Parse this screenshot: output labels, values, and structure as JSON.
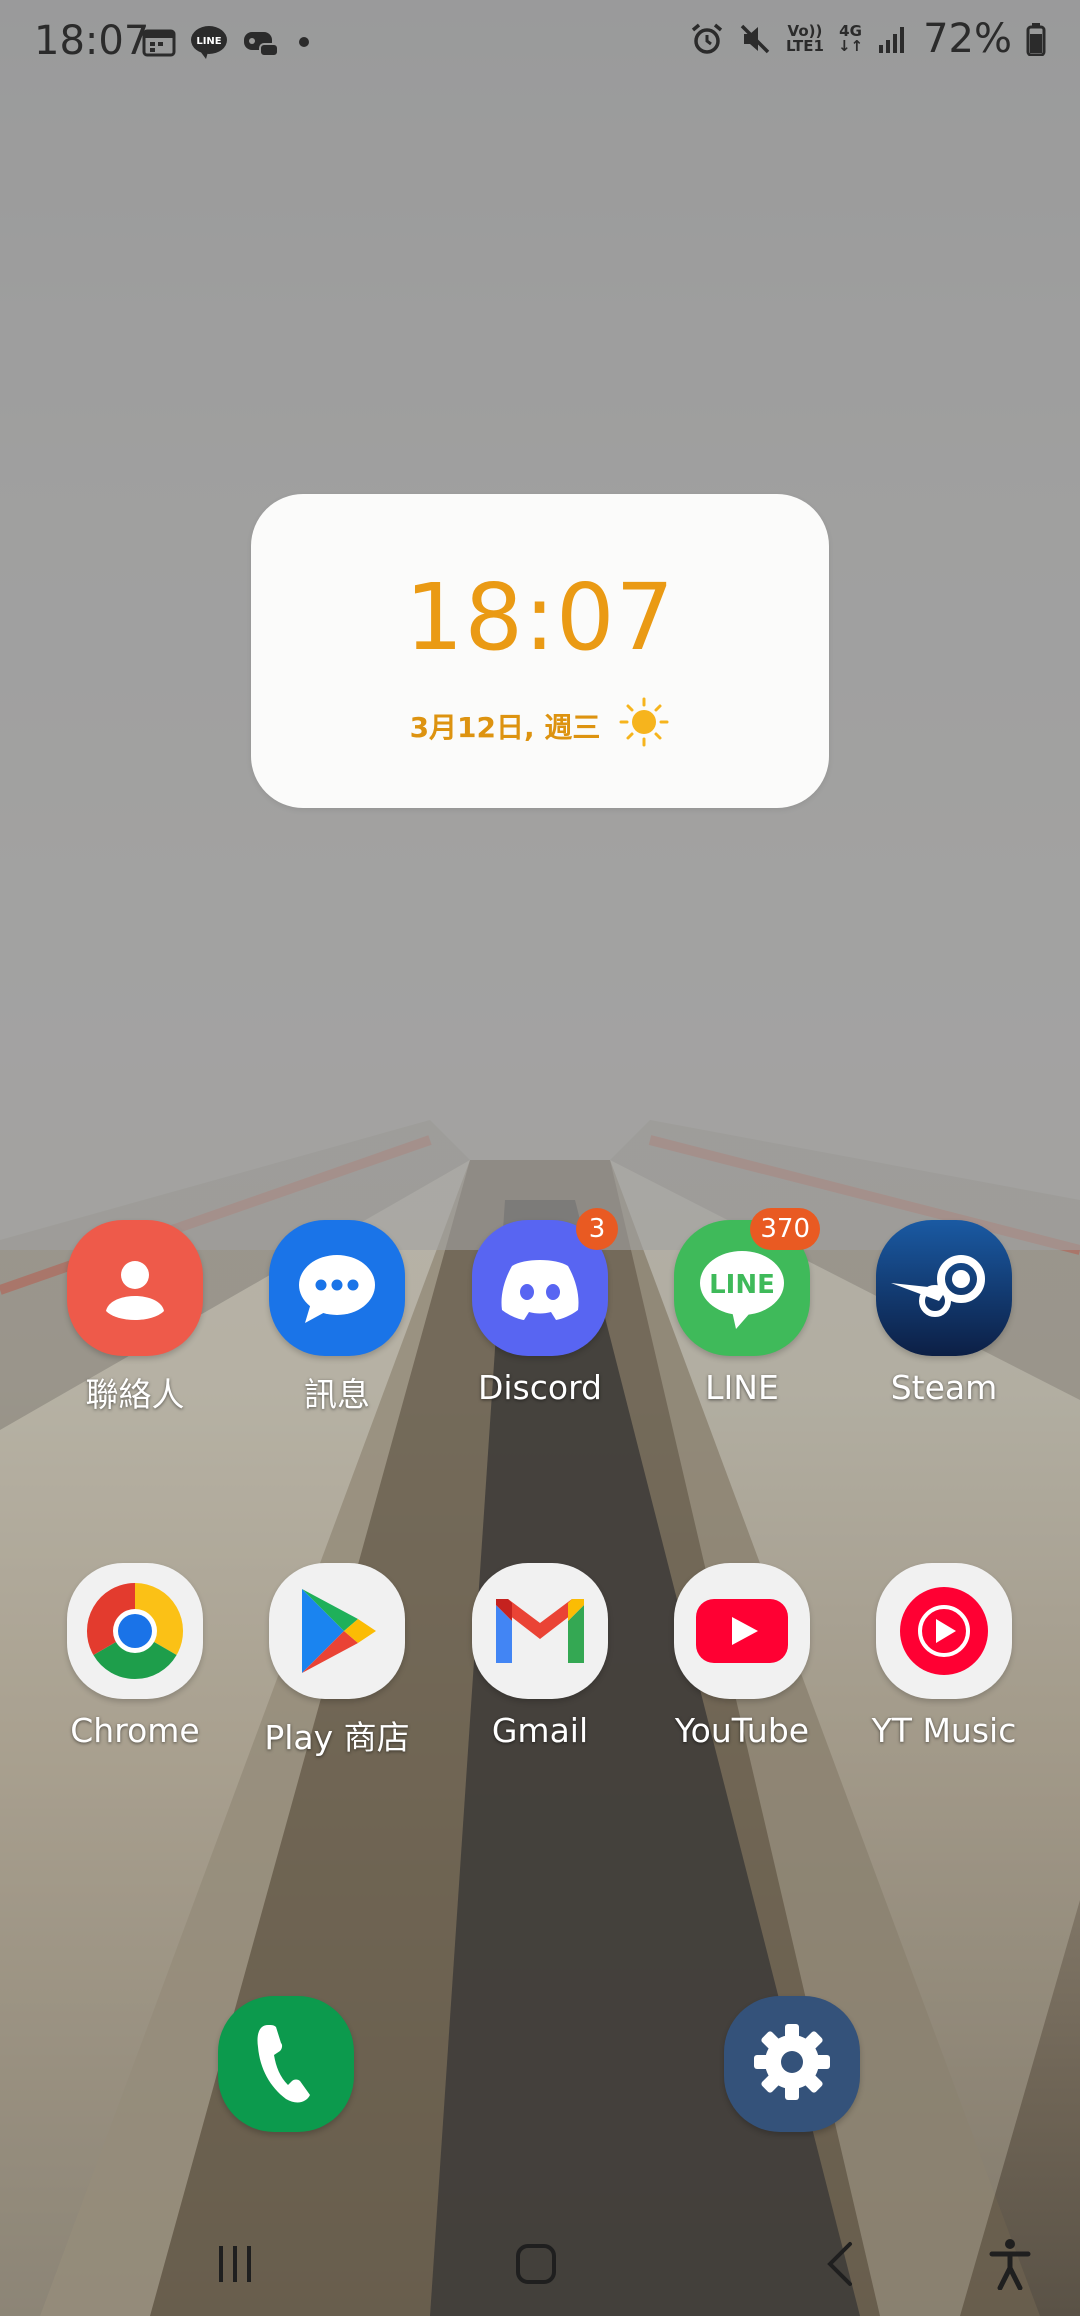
{
  "status_bar": {
    "time": "18:07",
    "left_icons": [
      "calendar-icon",
      "line-notification-icon",
      "gamepad-notification-icon",
      "more-notifications-dot"
    ],
    "network_top": "Vo))",
    "network_bottom": "LTE1",
    "network_type": "4G",
    "battery_percent": "72%"
  },
  "clock_widget": {
    "time": "18:07",
    "date": "3月12日, 週三",
    "weather_icon": "sun-icon",
    "accent_color": "#ea9a14"
  },
  "apps": [
    {
      "label": "聯絡人",
      "icon": "contacts-icon",
      "color": "#ee5a4a"
    },
    {
      "label": "訊息",
      "icon": "messages-icon",
      "color": "#1a74e8"
    },
    {
      "label": "Discord",
      "icon": "discord-icon",
      "color": "#5865f2",
      "badge": "3"
    },
    {
      "label": "LINE",
      "icon": "line-icon",
      "color": "#3fba5a",
      "badge": "370"
    },
    {
      "label": "Steam",
      "icon": "steam-icon",
      "color": "#0f2a56"
    },
    {
      "label": "Chrome",
      "icon": "chrome-icon",
      "color": "#f1f1f1"
    },
    {
      "label": "Play 商店",
      "icon": "play-store-icon",
      "color": "#f1f1f1"
    },
    {
      "label": "Gmail",
      "icon": "gmail-icon",
      "color": "#f1f1f1"
    },
    {
      "label": "YouTube",
      "icon": "youtube-icon",
      "color": "#f1f1f1"
    },
    {
      "label": "YT Music",
      "icon": "yt-music-icon",
      "color": "#f1f1f1"
    }
  ],
  "dock": [
    {
      "icon": "phone-icon",
      "color": "#0c9a4d"
    },
    {
      "icon": "settings-icon",
      "color": "#34527a"
    }
  ],
  "nav_bar": [
    "recent-apps-icon",
    "home-icon",
    "back-icon",
    "accessibility-icon"
  ]
}
